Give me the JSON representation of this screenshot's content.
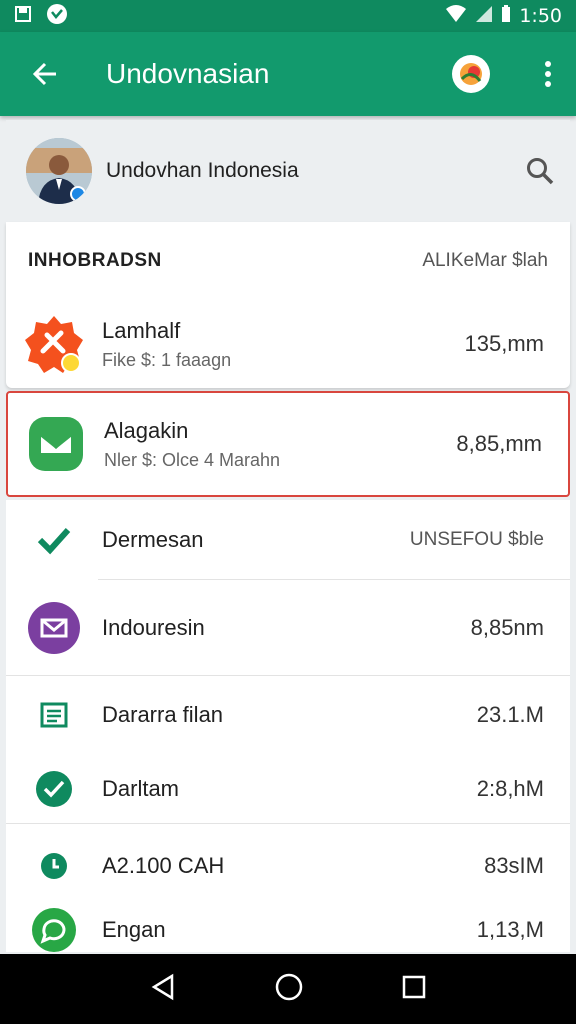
{
  "status": {
    "time": "1:50"
  },
  "app_bar": {
    "title": "Undovnasian"
  },
  "profile": {
    "name": "Undovhan Indonesia"
  },
  "section": {
    "title": "INHOBRADSN",
    "right_label": "ALIKeMar $lah"
  },
  "card_item": {
    "title": "Lamhalf",
    "subtitle": "Fike $: 1 faaagn",
    "value": "135,mm"
  },
  "selected_item": {
    "title": "Alagakin",
    "subtitle": "Nler $: Olce 4 Marahn",
    "value": "8,85,mm"
  },
  "list_items": [
    {
      "title": "Dermesan",
      "value": "UNSEFOU $ble",
      "icon": "check-icon"
    },
    {
      "title": "Indouresin",
      "value": "8,85nm",
      "icon": "mail-icon"
    },
    {
      "title": "Dararra filan",
      "value": "23.1.M",
      "icon": "document-icon"
    },
    {
      "title": "Darltam",
      "value": "2:8,hM",
      "icon": "check-circle-icon"
    },
    {
      "title": "A2.100 CAH",
      "value": "83sIM",
      "icon": "clock-icon"
    },
    {
      "title": "Engan",
      "value": "1,13,M",
      "icon": "chat-icon"
    }
  ],
  "colors": {
    "app_bar": "#129a6d",
    "status_bar": "#0f8a5f",
    "accent_red": "#d9463e"
  }
}
